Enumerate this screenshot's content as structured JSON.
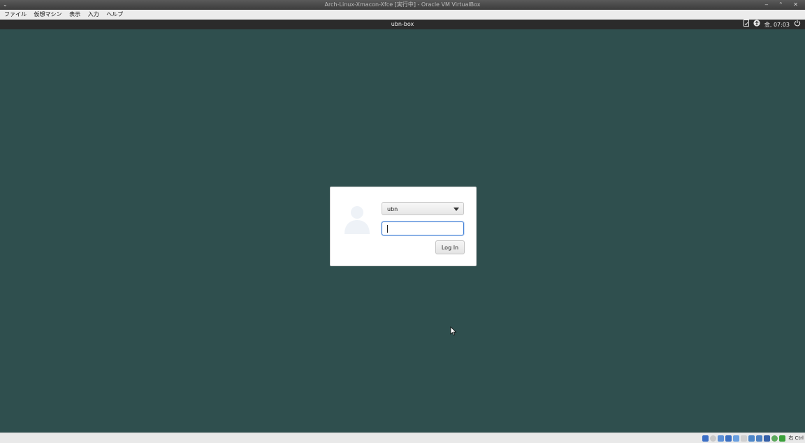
{
  "window": {
    "title": "Arch-Linux-Xmacon-Xfce [実行中] - Oracle VM VirtualBox",
    "menu_glyph": "⌄",
    "controls": "‒ ⌃ ✕"
  },
  "menubar": {
    "items": [
      "ファイル",
      "仮想マシン",
      "表示",
      "入力",
      "ヘルプ"
    ]
  },
  "topbar": {
    "hostname": "ubn-box",
    "clock": "金, 07:03"
  },
  "login": {
    "username": "ubn",
    "password_value": "",
    "login_label": "Log In"
  },
  "statusbar": {
    "host_key": "右 Ctrl",
    "icon_colors": [
      "#3b6fc6",
      "#c9c9c9",
      "#5b8fd6",
      "#3a6fc2",
      "#6aa0e0",
      "#4c86c8",
      "#d0d0d0",
      "#4b7fc0",
      "#3560a8",
      "#2d7cd6",
      "#5ca85c",
      "#3aa03a"
    ]
  },
  "colors": {
    "desktop": "#2f4f4e",
    "focus": "#3a7bd5"
  }
}
